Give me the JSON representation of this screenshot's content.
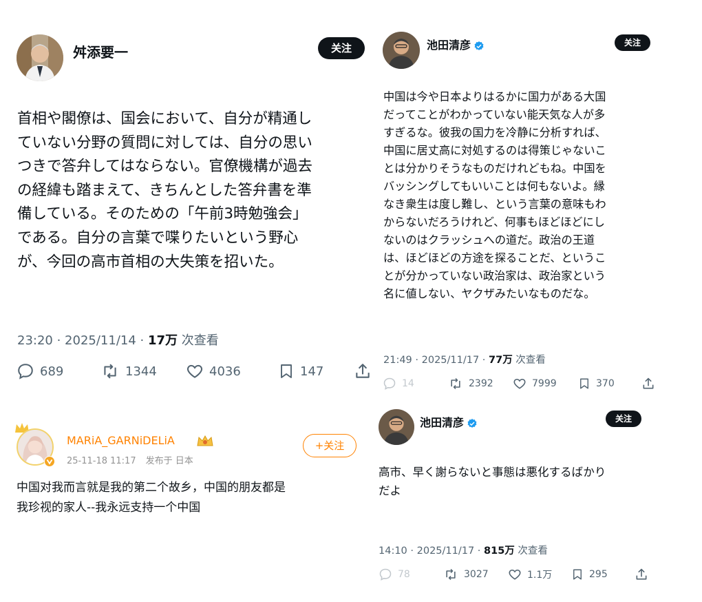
{
  "colors": {
    "text": "#0f1419",
    "secondary": "#536471",
    "verified": "#1d9bf0",
    "weibo_accent": "#ff8200"
  },
  "post1": {
    "author": "舛添要一",
    "follow_label": "关注",
    "text": "首相や閣僚は、国会において、自分が精通し\nていない分野の質問に対しては、自分の思い\nつきで答弁してはならない。官僚機構が過去\nの経緯も踏まえて、きちんとした答弁書を準\n備している。そのための「午前3時勉強会」\nである。自分の言葉で喋りたいという野心\nが、今回の高市首相の大失策を招いた。",
    "time": "23:20 · 2025/11/14 · ",
    "views": "17万",
    "views_suffix": " 次查看",
    "replies": "689",
    "reposts": "1344",
    "likes": "4036",
    "bookmarks": "147"
  },
  "post2": {
    "author": "池田清彦",
    "follow_label": "关注",
    "text": "中国は今や日本よりはるかに国力がある大国\nだってことがわかっていない能天気な人が多\nすぎるな。彼我の国力を冷静に分析すれば、\n中国に居丈高に対処するのは得策じゃないこ\nとは分かりそうなものだけれどもね。中国を\nバッシングしてもいいことは何もないよ。縁\nなき衆生は度し難し、という言葉の意味もわ\nからないだろうけれど、何事もほどほどにし\nないのはクラッシュへの道だ。政治の王道\nは、ほどほどの方途を探ることだ、というこ\nとが分かっていない政治家は、政治家という\n名に値しない、ヤクザみたいなものだな。",
    "time": "21:49 · 2025/11/17 · ",
    "views": "77万",
    "views_suffix": " 次查看",
    "replies": "14",
    "reposts": "2392",
    "likes": "7999",
    "bookmarks": "370"
  },
  "post3": {
    "author": "MARiA_GARNiDELiA",
    "date": "25-11-18 11:17",
    "location": "发布于 日本",
    "follow_label": "+关注",
    "text": "中国对我而言就是我的第二个故乡，中国的朋友都是\n我珍视的家人--我永远支持一个中国"
  },
  "post4": {
    "author": "池田清彦",
    "follow_label": "关注",
    "text": "高市、早く謝らないと事態は悪化するばかり\nだよ",
    "time": "14:10 · 2025/11/17 · ",
    "views": "815万",
    "views_suffix": " 次查看",
    "replies": "78",
    "reposts": "3027",
    "likes": "1.1万",
    "bookmarks": "295"
  }
}
